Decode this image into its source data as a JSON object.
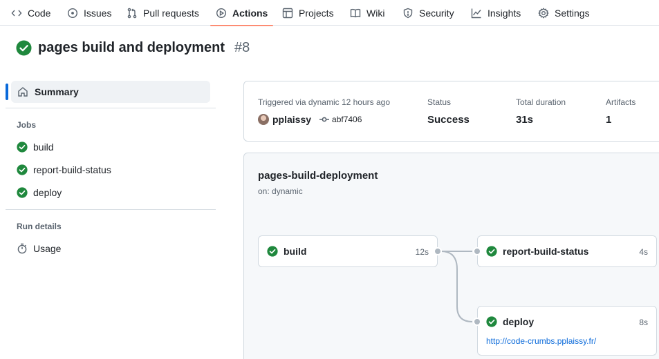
{
  "nav": {
    "items": [
      {
        "label": "Code",
        "icon": "code-icon"
      },
      {
        "label": "Issues",
        "icon": "issue-icon"
      },
      {
        "label": "Pull requests",
        "icon": "pull-request-icon"
      },
      {
        "label": "Actions",
        "icon": "play-icon"
      },
      {
        "label": "Projects",
        "icon": "table-icon"
      },
      {
        "label": "Wiki",
        "icon": "book-icon"
      },
      {
        "label": "Security",
        "icon": "shield-icon"
      },
      {
        "label": "Insights",
        "icon": "graph-icon"
      },
      {
        "label": "Settings",
        "icon": "gear-icon"
      }
    ],
    "active": "Actions"
  },
  "run": {
    "title": "pages build and deployment",
    "number": "#8"
  },
  "sidebar": {
    "summary_label": "Summary",
    "jobs_heading": "Jobs",
    "jobs": [
      {
        "label": "build"
      },
      {
        "label": "report-build-status"
      },
      {
        "label": "deploy"
      }
    ],
    "run_details_heading": "Run details",
    "usage_label": "Usage"
  },
  "summary": {
    "triggered_label": "Triggered via dynamic 12 hours ago",
    "actor": "pplaissy",
    "commit": "abf7406",
    "status_label": "Status",
    "status_value": "Success",
    "duration_label": "Total duration",
    "duration_value": "31s",
    "artifacts_label": "Artifacts",
    "artifacts_value": "1"
  },
  "workflow": {
    "name": "pages-build-deployment",
    "on": "on: dynamic",
    "jobs": {
      "build": {
        "name": "build",
        "duration": "12s"
      },
      "report": {
        "name": "report-build-status",
        "duration": "4s"
      },
      "deploy": {
        "name": "deploy",
        "duration": "8s",
        "link": "http://code-crumbs.pplaissy.fr/"
      }
    }
  },
  "colors": {
    "success": "#1f883d",
    "accent_underline": "#fd8c73",
    "link": "#0969da"
  }
}
